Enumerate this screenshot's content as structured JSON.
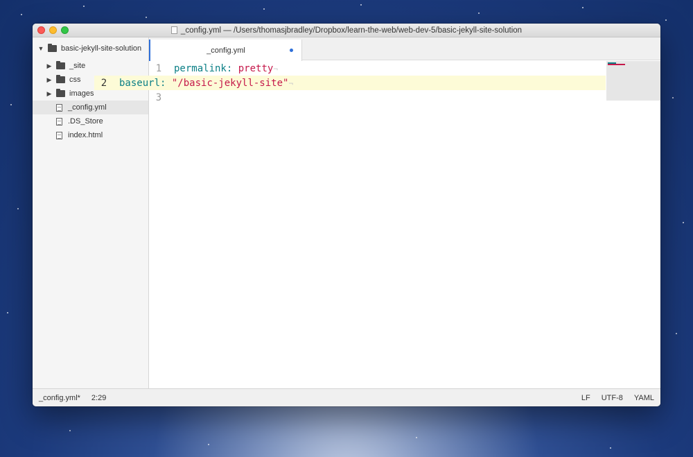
{
  "window": {
    "title": "_config.yml — /Users/thomasjbradley/Dropbox/learn-the-web/web-dev-5/basic-jekyll-site-solution"
  },
  "sidebar": {
    "root": "basic-jekyll-site-solution",
    "items": [
      {
        "type": "folder",
        "label": "_site"
      },
      {
        "type": "folder",
        "label": "css"
      },
      {
        "type": "folder",
        "label": "images"
      },
      {
        "type": "file",
        "label": "_config.yml",
        "selected": true
      },
      {
        "type": "file",
        "label": ".DS_Store"
      },
      {
        "type": "file",
        "label": "index.html"
      }
    ]
  },
  "tabs": [
    {
      "label": "_config.yml",
      "modified": true,
      "active": true
    }
  ],
  "code": {
    "lines": [
      {
        "number": "1",
        "key": "permalink:",
        "value": "pretty",
        "eol": "¬"
      },
      {
        "number": "2",
        "key": "baseurl:",
        "value": "\"/basic-jekyll-site\"",
        "eol": "¬"
      },
      {
        "number": "3",
        "key": "",
        "value": "",
        "eol": ""
      }
    ],
    "active_line": 2
  },
  "status": {
    "file": "_config.yml*",
    "cursor": "2:29",
    "line_ending": "LF",
    "encoding": "UTF-8",
    "grammar": "YAML"
  },
  "colors": {
    "key": "#0b7f86",
    "string": "#c5184a",
    "accent": "#2e6fd9",
    "active_line": "#fdfbd7"
  }
}
